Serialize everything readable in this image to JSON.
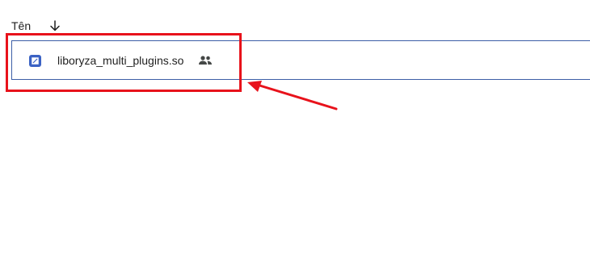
{
  "column_header": {
    "name_label": "Tên",
    "sort_icon": "arrow-down-icon"
  },
  "files": [
    {
      "name": "liboryza_multi_plugins.so",
      "type_icon": "binary-file-icon",
      "shared_icon": "people-icon",
      "selected": true
    }
  ],
  "annotation": {
    "color": "#e8121b",
    "shape": "rectangle-with-arrow"
  },
  "colors": {
    "row_border": "#3c5ea6",
    "file_icon": "#3b62c4",
    "text": "#1f1f1f"
  }
}
